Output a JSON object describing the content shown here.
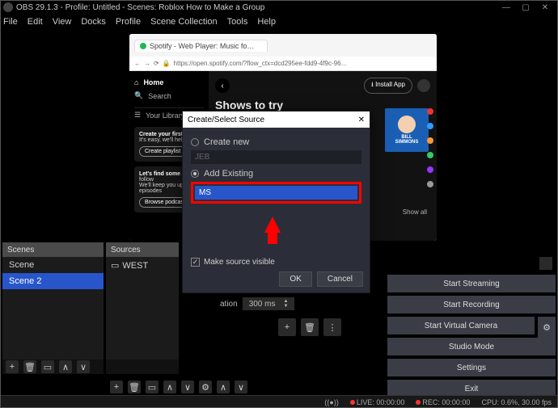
{
  "window": {
    "title": "OBS 29.1.3 - Profile: Untitled - Scenes: Roblox How to Make a Group",
    "min": "—",
    "max": "▢",
    "close": "✕"
  },
  "menu": [
    "File",
    "Edit",
    "View",
    "Docks",
    "Profile",
    "Scene Collection",
    "Tools",
    "Help"
  ],
  "browser": {
    "tab": "Spotify - Web Player: Music fo…",
    "url": "https://open.spotify.com/?flow_ctx=dcd295ee-fdd9-4f9c-96…"
  },
  "spotify": {
    "home": "Home",
    "search": "Search",
    "library": "Your Library",
    "promo1_title": "Create your first",
    "promo1_sub": "It's easy, we'll help y",
    "promo1_btn": "Create playlist",
    "promo2_title": "Let's find some p",
    "promo2_sub1": "follow",
    "promo2_sub2": "We'll keep you upd",
    "promo2_sub3": "episodes",
    "promo2_btn": "Browse podcast",
    "install": "Install App",
    "shows": "Shows to try",
    "showall": "Show all",
    "podcast1": "BILL",
    "podcast2": "SIMMONS"
  },
  "dialog": {
    "title": "Create/Select Source",
    "close": "✕",
    "create_new": "Create new",
    "name_placeholder": "JEB",
    "add_existing": "Add Existing",
    "existing_item": "MS",
    "make_visible": "Make source visible",
    "ok": "OK",
    "cancel": "Cancel"
  },
  "scenes": {
    "title": "Scenes",
    "items": [
      "Scene",
      "Scene 2"
    ],
    "selected": 1,
    "toolbar": [
      "+",
      "🗑",
      "▭",
      "∧",
      "∨"
    ]
  },
  "sources": {
    "title": "Sources",
    "item": "WEST",
    "toolbar": [
      "+",
      "🗑",
      "▭",
      "∧",
      "∨",
      "⚙",
      "∧",
      "∨"
    ]
  },
  "transition": {
    "label": "ation",
    "duration": "300 ms",
    "btns": [
      "+",
      "🗑",
      "⋮"
    ]
  },
  "controls": {
    "start_streaming": "Start Streaming",
    "start_recording": "Start Recording",
    "start_vcam": "Start Virtual Camera",
    "studio": "Studio Mode",
    "settings": "Settings",
    "exit": "Exit"
  },
  "status": {
    "live": "LIVE: 00:00:00",
    "rec": "REC: 00:00:00",
    "cpu": "CPU: 0.6%, 30.00 fps"
  }
}
